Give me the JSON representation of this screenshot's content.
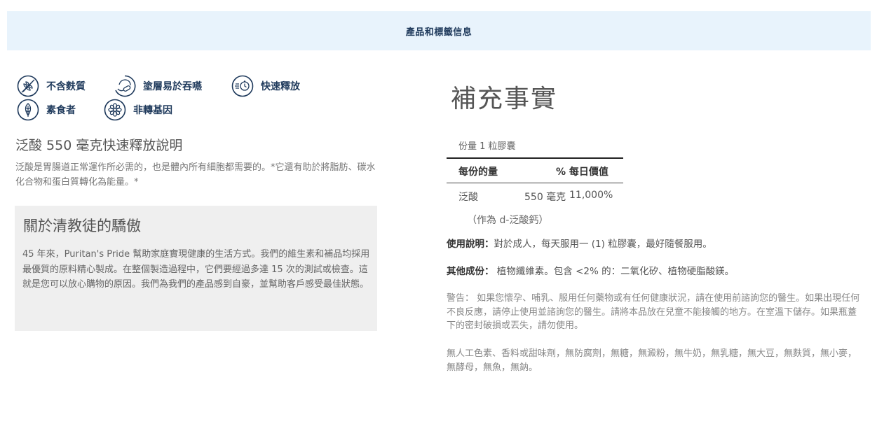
{
  "banner": {
    "title": "產品和標籤信息"
  },
  "badges": [
    {
      "icon": "wheat-free-icon",
      "label": "不含麩質"
    },
    {
      "icon": "easy-swallow-icon",
      "label": "塗層易於吞嚥"
    },
    {
      "icon": "quick-release-icon",
      "label": "快速釋放"
    },
    {
      "icon": "vegetarian-leaf-icon",
      "label": "素食者"
    },
    {
      "icon": "non-gmo-flower-icon",
      "label": "非轉基因"
    }
  ],
  "product": {
    "title": "泛酸 550 毫克快速釋放說明",
    "description": "泛酸是胃腸道正常運作所必需的，也是體內所有細胞都需要的。*它還有助於將脂肪、碳水化合物和蛋白質轉化為能量。*"
  },
  "about": {
    "heading": "關於清教徒的驕傲",
    "text": "45 年來，Puritan's Pride 幫助家庭實現健康的生活方式。我們的維生素和補品均採用最優質的原料精心製成。在整個製造過程中，它們要經過多達 15 次的測試或檢查。這就是您可以放心購物的原因。我們為我們的產品感到自豪，並幫助客戶感受最佳狀態。"
  },
  "supplement_facts": {
    "title": "補充事實",
    "serving": "份量 1 粒膠囊",
    "col_amount": "每份的量",
    "col_dv": "% 每日價值",
    "ingredient": {
      "name": "泛酸",
      "amount": "550 毫克",
      "dv": "11,000%",
      "form": "（作為 d-泛酸鈣）"
    }
  },
  "usage": {
    "label": "使用說明：",
    "text": "對於成人，每天服用一 (1) 粒膠囊，最好隨餐服用。"
  },
  "other": {
    "label": "其他成份：",
    "text": " 植物纖維素。包含 <2% 的：二氧化矽、植物硬脂酸鎂。"
  },
  "warning": {
    "text": "警告： 如果您懷孕、哺乳、服用任何藥物或有任何健康狀況，請在使用前諮詢您的醫生。如果出現任何不良反應，請停止使用並諮詢您的醫生。請將本品放在兒童不能接觸的地方。在室溫下儲存。如果瓶蓋下的密封破損或丟失，請勿使用。"
  },
  "free_from": {
    "text": "無人工色素、香料或甜味劑，無防腐劑，無糖，無澱粉，無牛奶，無乳糖，無大豆，無麩質，無小麥，無酵母，無魚，無鈉。"
  },
  "colors": {
    "icon_stroke": "#1f3a5c",
    "banner_bg": "#e8f3fc",
    "box_bg": "#efefef"
  }
}
